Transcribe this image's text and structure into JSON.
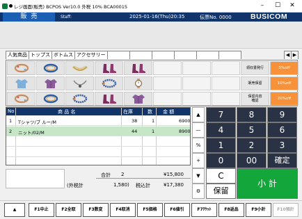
{
  "window": {
    "title": "レジ画面(販売) BCPOS Ver10.0 外税 10% BCA00015",
    "min": "–",
    "max": "☐",
    "close": "✕"
  },
  "header": {
    "mode": "販売",
    "staff_label": "Staff:",
    "datetime": "2025-01-16(Thu)20:35",
    "slip_label": "伝票No. 0000",
    "brand": "BUSICOM"
  },
  "tabs": [
    "人気商品",
    "トップス",
    "ボトムス",
    "アクセサリー",
    "",
    "",
    "",
    "",
    "",
    ""
  ],
  "tab_arrows": [
    "◀",
    "▶"
  ],
  "products": [
    {
      "icon": "bracelet-icon"
    },
    {
      "icon": "bracelet-blue-icon"
    },
    {
      "icon": "necklace-gold-icon"
    },
    {
      "icon": "boots-purple-icon"
    },
    {
      "icon": "boots-purple-icon"
    },
    {
      "icon": "tshirt-icon"
    },
    {
      "icon": "shirt-purple-icon"
    },
    {
      "icon": "necklace-silver-icon"
    },
    {
      "icon": "bracelet-beads-icon"
    },
    {
      "icon": "watch-icon"
    },
    {
      "icon": "bracelet-icon"
    },
    {
      "icon": "bracelet-blue-icon"
    },
    {
      "icon": "bracelet-beads-icon"
    },
    {
      "icon": "boots-purple-icon"
    },
    {
      "icon": "shirt-purple-icon"
    }
  ],
  "functions": [
    "領収書発行",
    "販売保留",
    "保留内容\n確認"
  ],
  "discounts": [
    "5%off",
    "10%off",
    "20%off"
  ],
  "item_table": {
    "headers": {
      "no": "No",
      "name": "商 品 名",
      "stock": "在庫",
      "qty": "数",
      "amount": "金 額"
    },
    "rows": [
      {
        "no": "1",
        "name": "Tシャツ/ブ ルー/M",
        "stock": "38",
        "qty": "1",
        "amount": "6900"
      },
      {
        "no": "2",
        "name": "ニット/02/M",
        "stock": "44",
        "qty": "1",
        "amount": "8900"
      }
    ]
  },
  "totals": {
    "total_label": "合計",
    "total_qty": "2",
    "total_amount": "¥15,800",
    "tax_excl_label": "(外税計",
    "tax_excl_value": "1,580)",
    "tax_incl_label": "税込計",
    "tax_incl_amount": "¥17,380"
  },
  "side_buttons": [
    "▲",
    "—",
    "%",
    "+",
    "▼",
    "⚙"
  ],
  "numpad": {
    "keys": [
      "7",
      "8",
      "9",
      "4",
      "5",
      "6",
      "1",
      "2",
      "3",
      "0",
      "00",
      "確定"
    ],
    "clear": "C",
    "hold": "保留",
    "subtotal": "小 計"
  },
  "fkeys": [
    {
      "label": "▲",
      "enabled": true
    },
    {
      "label": "F1中止",
      "enabled": true
    },
    {
      "label": "F2全取",
      "enabled": true
    },
    {
      "label": "F3数変",
      "enabled": true
    },
    {
      "label": "F4取消",
      "enabled": true
    },
    {
      "label": "F5価格",
      "enabled": true
    },
    {
      "label": "F6値引",
      "enabled": true
    },
    {
      "label": "F7ﾁｹｯﾄ",
      "enabled": true
    },
    {
      "label": "F8返品",
      "enabled": true
    },
    {
      "label": "F9小計",
      "enabled": true
    },
    {
      "label": "F10預計",
      "enabled": false
    }
  ],
  "colors": {
    "header_bg": "#11356b",
    "mode_bg": "#1a5fb4",
    "numpad_dark": "#2a3345",
    "subtotal_green": "#13a63b",
    "discount_orange": "#f7923a",
    "selected_row": "#c5e7c8"
  }
}
